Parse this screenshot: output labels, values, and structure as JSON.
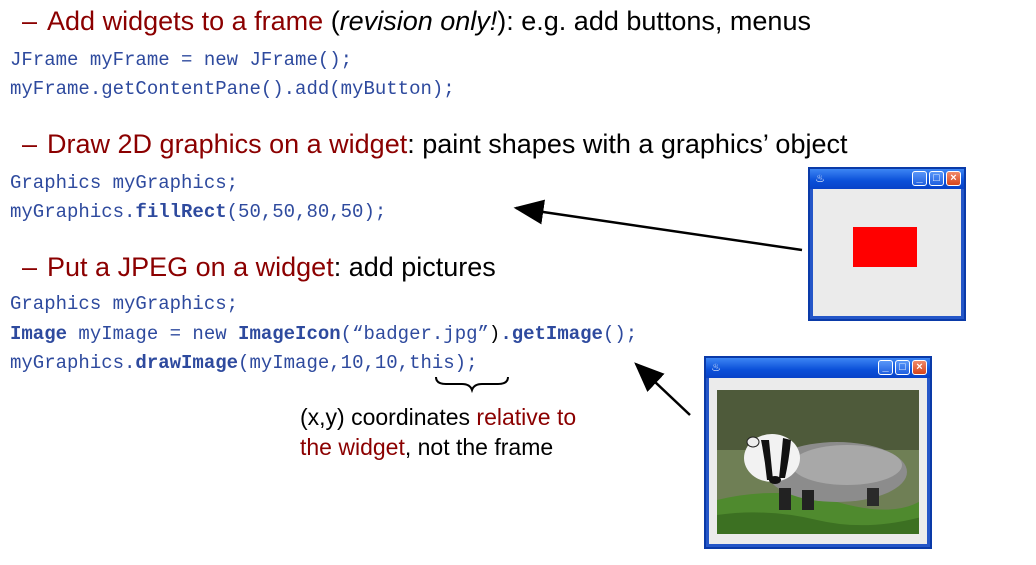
{
  "section1": {
    "dash": "–",
    "h_red": "Add widgets to a frame",
    "h_open": " (",
    "h_italic": "revision only!",
    "h_close": "): e.g. add buttons, menus",
    "code_line1": "JFrame myFrame = new JFrame();",
    "code_line2": "myFrame.getContentPane().add(myButton);"
  },
  "section2": {
    "dash": "–",
    "h_red": "Draw 2D graphics on a widget",
    "h_rest": ": paint shapes with a graphics’ object",
    "code_line1": "Graphics myGraphics;",
    "code_line2_a": "myGraphics.",
    "code_line2_b": "fillRect",
    "code_line2_c": "(50,50,80,50);"
  },
  "section3": {
    "dash": "–",
    "h_red": "Put a JPEG on a widget",
    "h_rest": ": add pictures",
    "code_line1": "Graphics myGraphics;",
    "code_line2_a": "Image",
    "code_line2_b": " myImage = new ",
    "code_line2_c": "ImageIcon",
    "code_line2_d": "(“badger.jpg”",
    "code_line2_e": ")",
    "code_line2_f": ".getImage",
    "code_line2_g": "();",
    "code_line3_a": "myGraphics.",
    "code_line3_b": "drawImage",
    "code_line3_c": "(myImage,10,10,this);"
  },
  "note": {
    "line1_a": "(x,y) coordinates ",
    "line1_b": "relative to",
    "line2_a": "the widget",
    "line2_b": ", not the frame"
  },
  "colors": {
    "heading_red": "#8b0000",
    "code_blue": "#2e4a9e",
    "xp_blue": "#2456c8",
    "shape_red": "#ff0000"
  },
  "icons": [
    "java-cup-icon",
    "minimize-icon",
    "maximize-icon",
    "close-icon"
  ]
}
